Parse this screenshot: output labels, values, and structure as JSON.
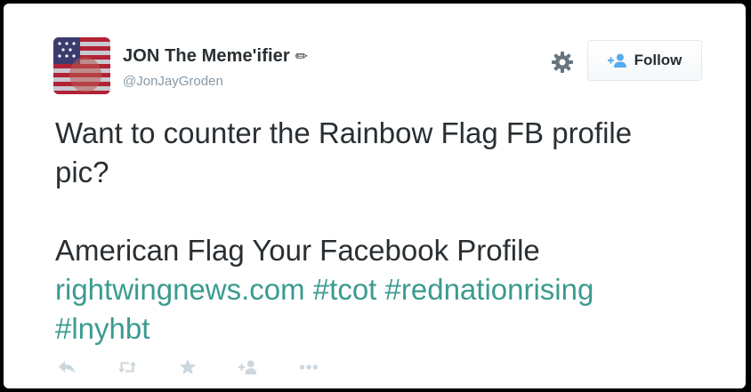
{
  "user": {
    "display_name": "JON The Meme'ifier",
    "name_icon": "pencil-icon",
    "handle": "@JonJayGroden"
  },
  "header": {
    "settings_icon": "gear-icon",
    "follow_label": "Follow",
    "follow_icon": "add-user-icon"
  },
  "tweet": {
    "line1": "Want to counter the Rainbow Flag FB profile",
    "line2": "pic?",
    "line3": "American Flag Your Facebook Profile",
    "link_url": "rightwingnews.com",
    "hashtag1": "#tcot",
    "hashtag2": "#rednationrising",
    "hashtag3": "#lnyhbt"
  },
  "actions": [
    "reply-icon",
    "retweet-icon",
    "favorite-icon",
    "follow-icon",
    "more-icon"
  ],
  "colors": {
    "link": "#3b9b8f",
    "text": "#292f33",
    "muted": "#8899a6",
    "action_icons": "#ccd6dd"
  }
}
